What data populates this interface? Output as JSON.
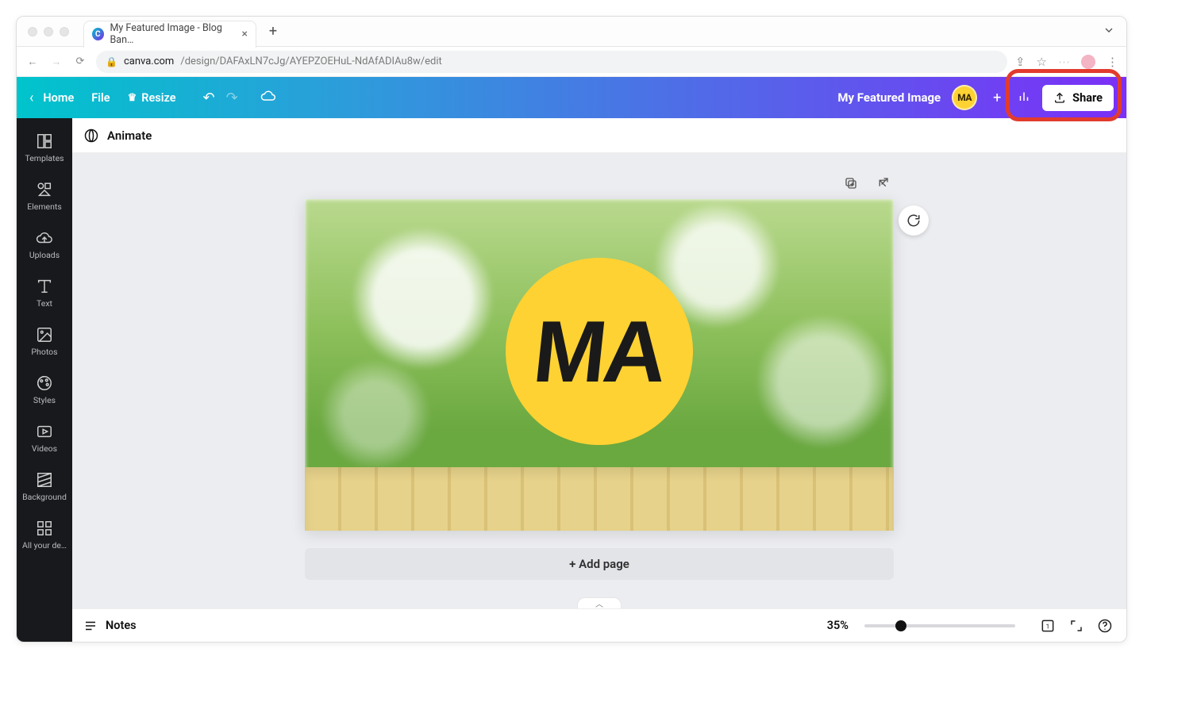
{
  "browser": {
    "tab_title": "My Featured Image - Blog Ban…",
    "url_host": "canva.com",
    "url_path": "/design/DAFAxLN7cJg/AYEPZOEHuL-NdAfADIAu8w/edit"
  },
  "topbar": {
    "home": "Home",
    "file": "File",
    "resize": "Resize",
    "doc_title": "My Featured Image",
    "avatar_initials": "MA",
    "share": "Share"
  },
  "sidebar": {
    "items": [
      {
        "key": "templates",
        "label": "Templates"
      },
      {
        "key": "elements",
        "label": "Elements"
      },
      {
        "key": "uploads",
        "label": "Uploads"
      },
      {
        "key": "text",
        "label": "Text"
      },
      {
        "key": "photos",
        "label": "Photos"
      },
      {
        "key": "styles",
        "label": "Styles"
      },
      {
        "key": "videos",
        "label": "Videos"
      },
      {
        "key": "background",
        "label": "Background"
      },
      {
        "key": "all-designs",
        "label": "All your de…"
      }
    ]
  },
  "subbar": {
    "animate": "Animate"
  },
  "canvas": {
    "logo_text": "MA",
    "add_page": "+ Add page"
  },
  "footer": {
    "notes": "Notes",
    "zoom": "35%",
    "page_indicator": "1"
  }
}
